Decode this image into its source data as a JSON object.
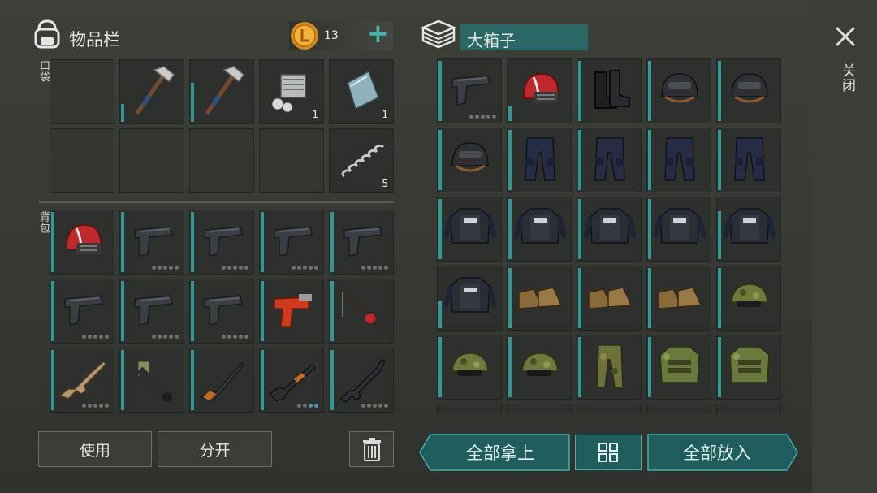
{
  "inventory": {
    "title": "物品栏",
    "coins": "13",
    "add_symbol": "+",
    "pocket_label": "口袋",
    "backpack_label": "背包"
  },
  "container": {
    "title": "大箱子",
    "close_label": "关闭"
  },
  "buttons": {
    "use": "使用",
    "split": "分开",
    "take_all": "全部拿上",
    "put_all": "全部放入"
  },
  "pocket_slots": [
    {
      "icon": "empty"
    },
    {
      "icon": "hatchet",
      "bar": 0.3
    },
    {
      "icon": "hatchet",
      "bar": 0.65
    },
    {
      "icon": "engine-part",
      "count": "1"
    },
    {
      "icon": "metal-plate",
      "count": "1"
    },
    {
      "icon": "empty"
    },
    {
      "icon": "empty"
    },
    {
      "icon": "empty"
    },
    {
      "icon": "empty"
    },
    {
      "icon": "spring",
      "count": "5"
    }
  ],
  "backpack_slots": [
    {
      "icon": "red-helmet",
      "bar": 1
    },
    {
      "icon": "pistol",
      "bar": 1,
      "dots": 5
    },
    {
      "icon": "pistol",
      "bar": 1,
      "dots": 5
    },
    {
      "icon": "pistol",
      "bar": 1,
      "dots": 5
    },
    {
      "icon": "pistol",
      "bar": 1,
      "dots": 5
    },
    {
      "icon": "pistol",
      "bar": 1,
      "dots": 5
    },
    {
      "icon": "pistol",
      "bar": 1,
      "dots": 5
    },
    {
      "icon": "pistol",
      "bar": 1,
      "dots": 5
    },
    {
      "icon": "flare-gun",
      "bar": 1
    },
    {
      "icon": "fishing-rod",
      "bar": 1
    },
    {
      "icon": "assault-rifle",
      "bar": 1,
      "dots": 5
    },
    {
      "icon": "grenade-launcher",
      "bar": 1
    },
    {
      "icon": "hunting-rifle",
      "bar": 1
    },
    {
      "icon": "shotgun",
      "bar": 1,
      "dots": 4,
      "loaded": 2
    },
    {
      "icon": "m16-rifle",
      "bar": 1,
      "dots": 5
    }
  ],
  "chest_slots": [
    {
      "icon": "pistol",
      "bar": 1,
      "dots": 5
    },
    {
      "icon": "red-helmet",
      "bar": 0.25
    },
    {
      "icon": "boots",
      "bar": 1
    },
    {
      "icon": "military-helmet",
      "bar": 1
    },
    {
      "icon": "military-helmet",
      "bar": 1
    },
    {
      "icon": "military-helmet",
      "bar": 1
    },
    {
      "icon": "police-pants",
      "bar": 1
    },
    {
      "icon": "police-pants",
      "bar": 1
    },
    {
      "icon": "police-pants",
      "bar": 1
    },
    {
      "icon": "police-pants",
      "bar": 1
    },
    {
      "icon": "police-vest",
      "bar": 1
    },
    {
      "icon": "police-vest",
      "bar": 1
    },
    {
      "icon": "police-vest",
      "bar": 1
    },
    {
      "icon": "police-vest",
      "bar": 1
    },
    {
      "icon": "police-vest",
      "bar": 0.8
    },
    {
      "icon": "police-vest",
      "bar": 0.45
    },
    {
      "icon": "tan-boots",
      "bar": 1
    },
    {
      "icon": "tan-boots",
      "bar": 1
    },
    {
      "icon": "tan-boots",
      "bar": 1
    },
    {
      "icon": "camo-cap",
      "bar": 1
    },
    {
      "icon": "camo-cap",
      "bar": 1
    },
    {
      "icon": "camo-cap",
      "bar": 1
    },
    {
      "icon": "camo-pants",
      "bar": 1
    },
    {
      "icon": "camo-vest",
      "bar": 1
    },
    {
      "icon": "camo-vest",
      "bar": 1
    }
  ]
}
